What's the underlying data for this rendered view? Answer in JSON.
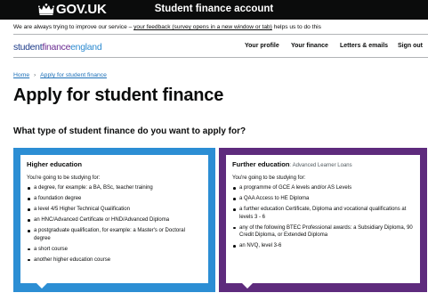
{
  "header": {
    "logo_text": "GOV.UK",
    "service_name": "Student finance account"
  },
  "feedback": {
    "prefix": "We are always trying to improve our service – ",
    "link": "your feedback (survey opens in a new window or tab)",
    "suffix": " helps us to do this"
  },
  "brand": {
    "part1": "student",
    "part2": "finance",
    "part3": "england"
  },
  "nav": {
    "items": [
      {
        "label": "Your profile"
      },
      {
        "label": "Your finance"
      },
      {
        "label": "Letters & emails"
      },
      {
        "label": "Sign out"
      }
    ]
  },
  "breadcrumb": {
    "home": "Home",
    "current": "Apply for student finance"
  },
  "page_title": "Apply for student finance",
  "question": "What type of student finance do you want to apply for?",
  "cards": [
    {
      "title": "Higher education",
      "subtitle": "",
      "intro": "You're going to be studying for:",
      "items": [
        "a degree, for example: a BA, BSc, teacher training",
        "a foundation degree",
        "a level 4/5 Higher Technical Qualification",
        "an HNC/Advanced Certificate or HND/Advanced Diploma",
        "a postgraduate qualification, for example: a Master's or Doctoral degree",
        "a short course",
        "another higher education course"
      ],
      "color": "#2c8ed4"
    },
    {
      "title": "Further education",
      "subtitle": ": Advanced Learner Loans",
      "intro": "You're going to be studying for:",
      "items": [
        "a programme of GCE A levels and/or AS Levels",
        "a QAA Access to HE Diploma",
        "a further education Certificate, Diploma and vocational qualifications at levels 3 - 6",
        "any of the following BTEC Professional awards: a Subsidiary Diploma, 90 Credit Diploma, or Extended Diploma",
        "an NVQ, level 3-6"
      ],
      "color": "#5e2b7d"
    }
  ],
  "colors": {
    "header_bg": "#0b0c0c",
    "link": "#1d70b8"
  }
}
